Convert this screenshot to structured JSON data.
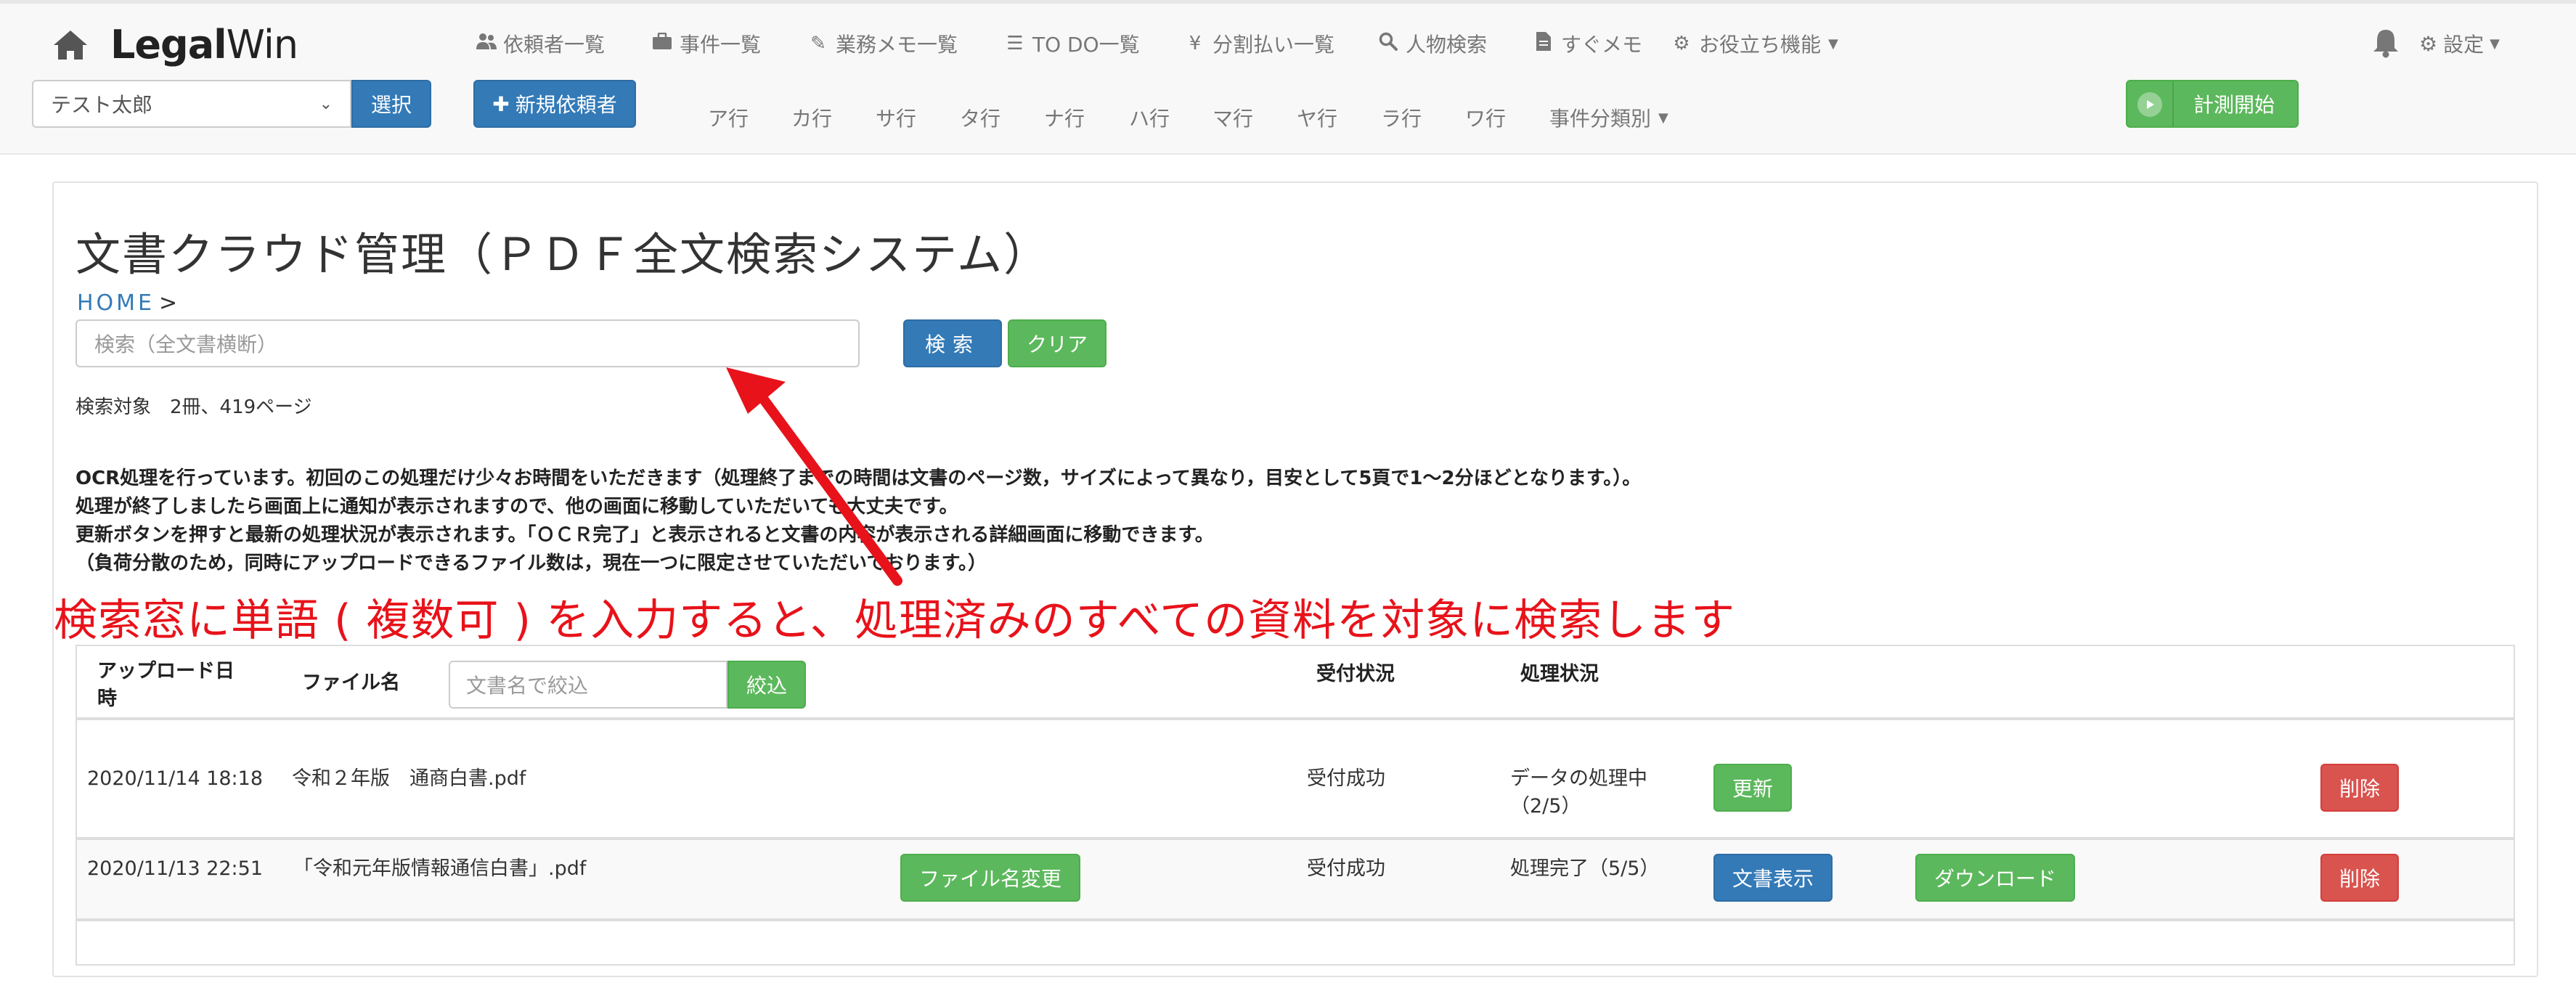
{
  "navbar": {
    "brand_bold": "Legal",
    "brand_light": "Win",
    "client_selected": "テスト太郎",
    "select_label": "選択",
    "new_client_label": "新規依頼者",
    "menu": [
      {
        "label": "依頼者一覧",
        "icon": "users-icon"
      },
      {
        "label": "事件一覧",
        "icon": "briefcase-icon"
      },
      {
        "label": "業務メモ一覧",
        "icon": "pencil-icon"
      },
      {
        "label": "TO DO一覧",
        "icon": "list-icon"
      },
      {
        "label": "分割払い一覧",
        "icon": "yen-icon"
      },
      {
        "label": "人物検索",
        "icon": "search-icon"
      },
      {
        "label": "すぐメモ",
        "icon": "file-icon"
      },
      {
        "label": "お役立ち機能",
        "icon": "gear-icon"
      }
    ],
    "kana_tabs": [
      "ア行",
      "カ行",
      "サ行",
      "タ行",
      "ナ行",
      "ハ行",
      "マ行",
      "ヤ行",
      "ラ行",
      "ワ行"
    ],
    "case_category_label": "事件分類別",
    "settings_label": "設定",
    "timer_label": "計測開始"
  },
  "page": {
    "title": "文書クラウド管理（ＰＤＦ全文検索システム）",
    "breadcrumb_home": "HOME",
    "breadcrumb_sep": ">",
    "search_placeholder": "検索（全文書横断）",
    "search_label": "検索",
    "clear_label": "クリア",
    "search_target": "検索対象　2冊、419ページ",
    "notice_lines": [
      "OCR処理を行っています。初回のこの処理だけ少々お時間をいただきます（処理終了までの時間は文書のページ数，サイズによって異なり，目安として5頁で1〜2分ほどとなります。）。",
      "処理が終了しましたら画面上に通知が表示されますので、他の画面に移動していただいても大丈夫です。",
      "更新ボタンを押すと最新の処理状況が表示されます。「ＯＣＲ完了」と表示されると文書の内容が表示される詳細画面に移動できます。",
      "（負荷分散のため，同時にアップロードできるファイル数は，現在一つに限定させていただいております。）"
    ],
    "annotation": "検索窓に単語 ( 複数可 ) を入力すると、処理済みのすべての資料を対象に検索します"
  },
  "table": {
    "headers": {
      "upload_date_line1": "アップロード日",
      "upload_date_line2": "時",
      "file_name": "ファイル名",
      "reception": "受付状況",
      "processing": "処理状況"
    },
    "filter_placeholder": "文書名で絞込",
    "filter_label": "絞込",
    "rows": [
      {
        "date": "2020/11/14 18:18",
        "file": "令和２年版　通商白書.pdf",
        "reception": "受付成功",
        "status_line1": "データの処理中",
        "status_line2": "（2/5）",
        "update_label": "更新",
        "delete_label": "削除"
      },
      {
        "date": "2020/11/13 22:51",
        "file": "「令和元年版情報通信白書」.pdf",
        "rename_label": "ファイル名変更",
        "reception": "受付成功",
        "status_line1": "処理完了（5/5）",
        "view_label": "文書表示",
        "download_label": "ダウンロード",
        "delete_label": "削除"
      }
    ]
  },
  "colors": {
    "primary": "#337ab7",
    "success": "#5cb85c",
    "danger": "#d9534f",
    "annotation_red": "#e8121a"
  }
}
